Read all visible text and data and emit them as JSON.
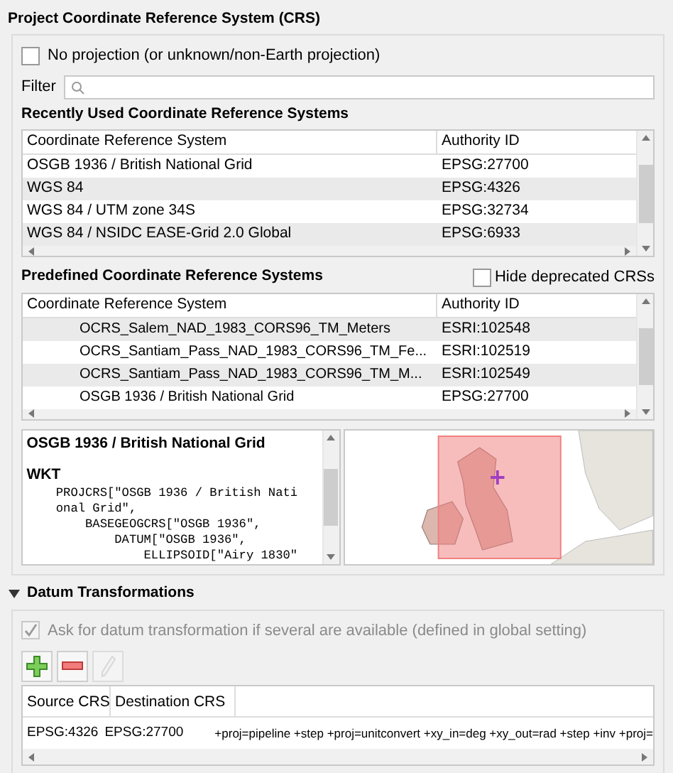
{
  "section_title": "Project Coordinate Reference System (CRS)",
  "no_projection": {
    "label": "No projection (or unknown/non-Earth projection)",
    "checked": false
  },
  "filter": {
    "label": "Filter"
  },
  "recent": {
    "title": "Recently Used Coordinate Reference Systems",
    "columns": [
      "Coordinate Reference System",
      "Authority ID"
    ],
    "rows": [
      {
        "name": "OSGB 1936 / British National Grid",
        "id": "EPSG:27700"
      },
      {
        "name": "WGS 84",
        "id": "EPSG:4326"
      },
      {
        "name": "WGS 84 / UTM zone 34S",
        "id": "EPSG:32734"
      },
      {
        "name": "WGS 84 / NSIDC EASE-Grid 2.0 Global",
        "id": "EPSG:6933"
      }
    ]
  },
  "predefined": {
    "title": "Predefined Coordinate Reference Systems",
    "hide_deprecated": {
      "label": "Hide deprecated CRSs",
      "checked": false
    },
    "columns": [
      "Coordinate Reference System",
      "Authority ID"
    ],
    "rows": [
      {
        "name": "OCRS_Salem_NAD_1983_CORS96_TM_Meters",
        "id": "ESRI:102548"
      },
      {
        "name": "OCRS_Santiam_Pass_NAD_1983_CORS96_TM_Fe...",
        "id": "ESRI:102519"
      },
      {
        "name": "OCRS_Santiam_Pass_NAD_1983_CORS96_TM_M...",
        "id": "ESRI:102549"
      },
      {
        "name": "OSGB 1936 / British National Grid",
        "id": "EPSG:27700"
      }
    ]
  },
  "details": {
    "name": "OSGB 1936 / British National Grid",
    "wkt_heading": "WKT",
    "wkt_lines": [
      "    PROJCRS[\"OSGB 1936 / British Nati",
      "    onal Grid\",",
      "        BASEGEOGCRS[\"OSGB 1936\",",
      "            DATUM[\"OSGB 1936\",",
      "                ELLIPSOID[\"Airy 1830\""
    ]
  },
  "datum": {
    "title": "Datum Transformations",
    "expanded": true,
    "ask": {
      "label": "Ask for datum transformation if several are available (defined in global setting)",
      "checked": true,
      "disabled": true
    },
    "tools": [
      {
        "kind": "add",
        "disabled": false
      },
      {
        "kind": "remove",
        "disabled": false
      },
      {
        "kind": "edit",
        "disabled": true
      }
    ],
    "columns": [
      "Source CRS",
      "Destination CRS"
    ],
    "rows": [
      {
        "source": "EPSG:4326",
        "destination": "EPSG:27700",
        "column_3": "+proj=pipeline +step +proj=unitconvert +xy_in=deg +xy_out=rad +step +inv +proj="
      }
    ]
  }
}
